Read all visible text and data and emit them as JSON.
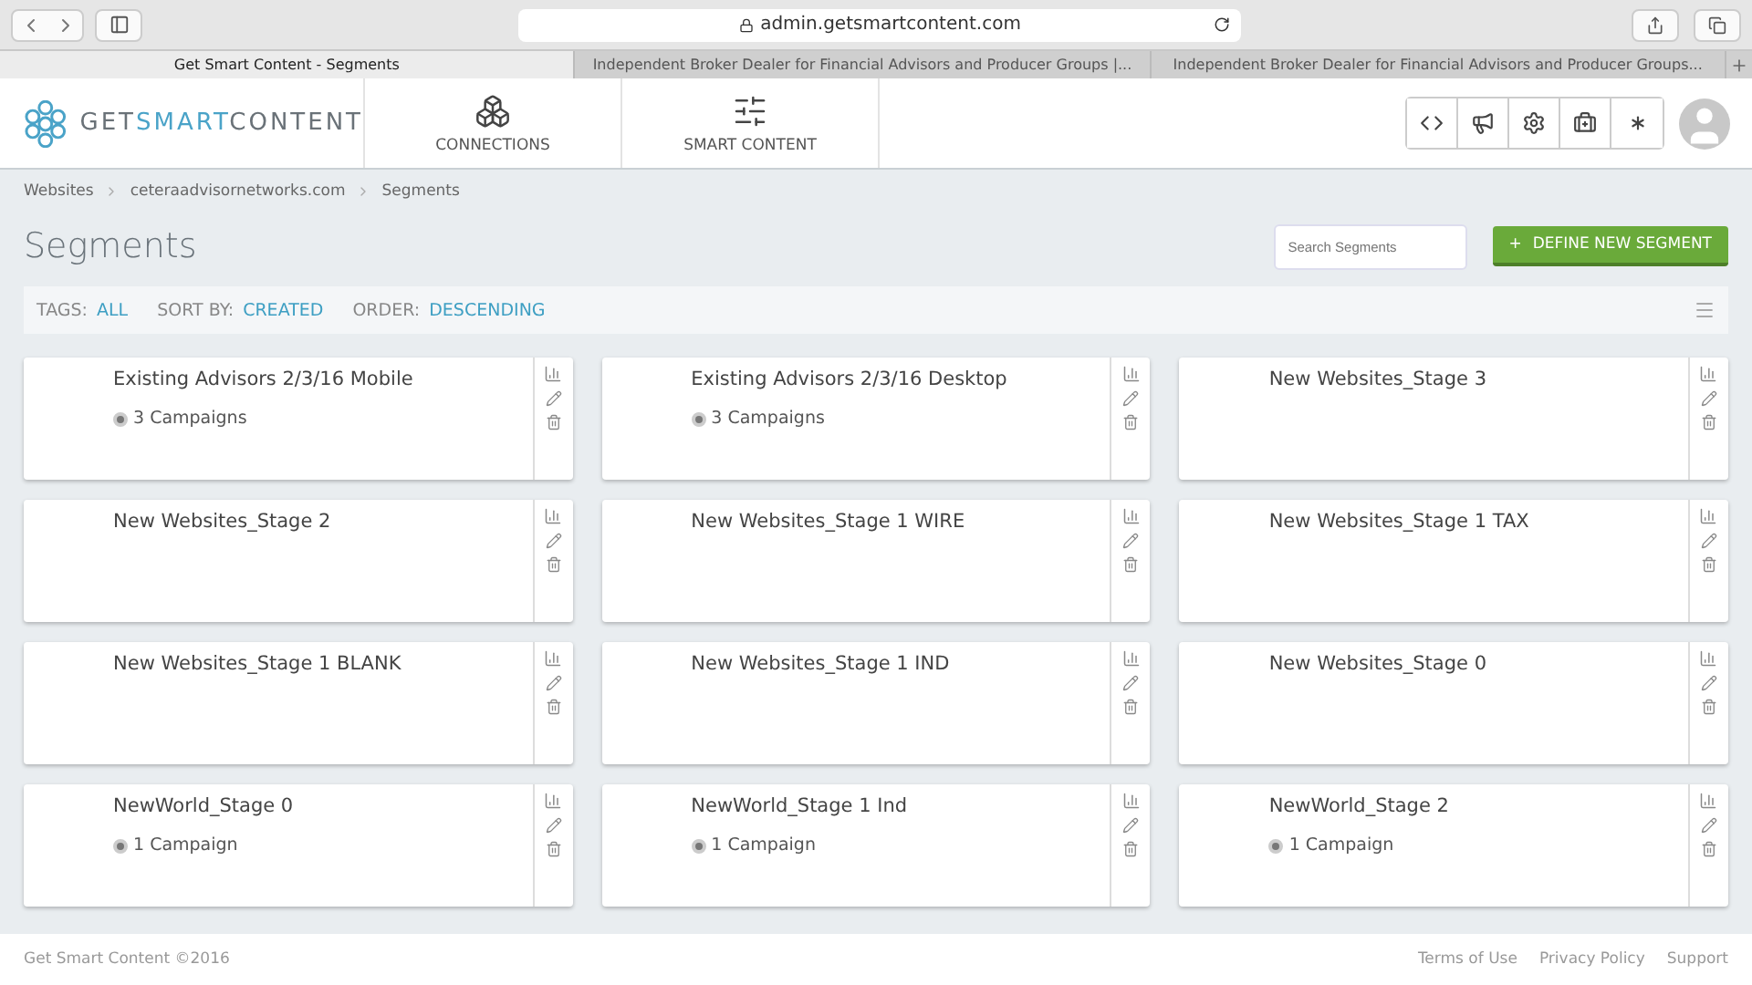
{
  "browser": {
    "url": "admin.getsmartcontent.com",
    "tabs": [
      {
        "label": "Get Smart Content - Segments",
        "selected": true
      },
      {
        "label": "Independent Broker Dealer for Financial Advisors and Producer Groups |...",
        "selected": false
      },
      {
        "label": "Independent Broker Dealer for Financial Advisors and Producer Groups...",
        "selected": false
      }
    ]
  },
  "header": {
    "logo": {
      "part1": "GET",
      "part2": "SMART",
      "part3": "CONTENT"
    },
    "nav": [
      {
        "label": "CONNECTIONS",
        "kind": "connections"
      },
      {
        "label": "SMART CONTENT",
        "kind": "sliders"
      }
    ]
  },
  "breadcrumb": [
    "Websites",
    "ceteraadvisornetworks.com",
    "Segments"
  ],
  "title": "Segments",
  "search": {
    "placeholder": "Search Segments"
  },
  "define_button": {
    "icon": "+",
    "label": "DEFINE NEW SEGMENT"
  },
  "filters": [
    {
      "label": "TAGS:",
      "value": "ALL"
    },
    {
      "label": "SORT BY:",
      "value": "CREATED"
    },
    {
      "label": "ORDER:",
      "value": "DESCENDING"
    }
  ],
  "segments": [
    {
      "name": "Existing Advisors 2/3/16 Mobile",
      "campaigns": "3 Campaigns"
    },
    {
      "name": "Existing Advisors 2/3/16 Desktop",
      "campaigns": "3 Campaigns"
    },
    {
      "name": "New Websites_Stage 3"
    },
    {
      "name": "New Websites_Stage 2"
    },
    {
      "name": "New Websites_Stage 1 WIRE"
    },
    {
      "name": "New Websites_Stage 1 TAX"
    },
    {
      "name": "New Websites_Stage 1 BLANK"
    },
    {
      "name": "New Websites_Stage 1 IND"
    },
    {
      "name": "New Websites_Stage 0"
    },
    {
      "name": "NewWorld_Stage 0",
      "campaigns": "1 Campaign"
    },
    {
      "name": "NewWorld_Stage 1 Ind",
      "campaigns": "1 Campaign"
    },
    {
      "name": "NewWorld_Stage 2",
      "campaigns": "1 Campaign"
    }
  ],
  "footer": {
    "copyright": "Get Smart Content ©2016",
    "links": [
      "Terms of Use",
      "Privacy Policy",
      "Support"
    ]
  }
}
